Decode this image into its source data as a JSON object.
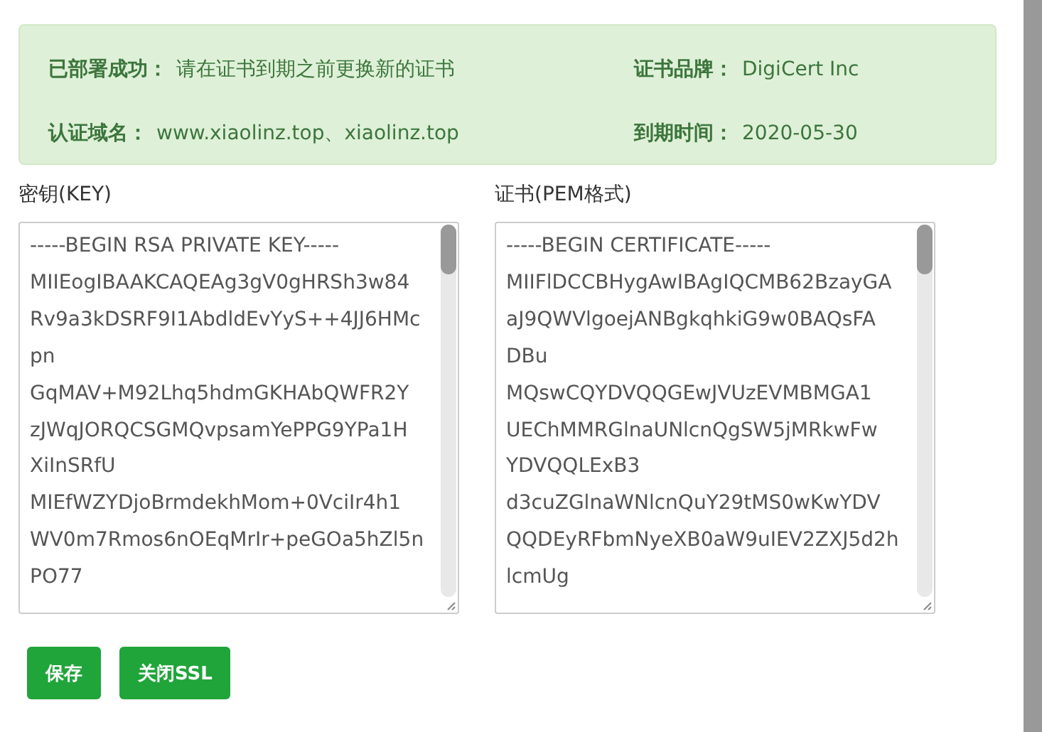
{
  "info": [
    {
      "label": "已部署成功：",
      "value": "请在证书到期之前更换新的证书"
    },
    {
      "label": "证书品牌：",
      "value": "DigiCert Inc"
    },
    {
      "label": "认证域名：",
      "value": "www.xiaolinz.top、xiaolinz.top"
    },
    {
      "label": "到期时间：",
      "value": "2020-05-30"
    }
  ],
  "fields": [
    {
      "label": "密钥(KEY)",
      "lines": [
        "-----BEGIN RSA PRIVATE KEY-----",
        "MIIEogIBAAKCAQEAg3gV0gHRSh3w84",
        "Rv9a3kDSRF9I1AbdldEvYyS++4JJ6HMc",
        "pn",
        "GqMAV+M92Lhq5hdmGKHAbQWFR2Y",
        "zJWqJORQCSGMQvpsamYePPG9YPa1H",
        "XiInSRfU",
        "MIEfWZYDjoBrmdekhMom+0VciIr4h1",
        "WV0m7Rmos6nOEqMrIr+peGOa5hZl5n",
        "PO77"
      ]
    },
    {
      "label": "证书(PEM格式)",
      "lines": [
        "-----BEGIN CERTIFICATE-----",
        "MIIFlDCCBHygAwIBAgIQCMB62BzayGA",
        "aJ9QWVlgoejANBgkqhkiG9w0BAQsFA",
        "DBu",
        "MQswCQYDVQQGEwJVUzEVMBMGA1",
        "UEChMMRGlnaUNlcnQgSW5jMRkwFw",
        "YDVQQLExB3",
        "d3cuZGlnaWNlcnQuY29tMS0wKwYDV",
        "QQDEyRFbmNyeXB0aW9uIEV2ZXJ5d2h",
        "lcmUg"
      ]
    }
  ],
  "buttons": [
    "保存",
    "关闭SSL"
  ]
}
